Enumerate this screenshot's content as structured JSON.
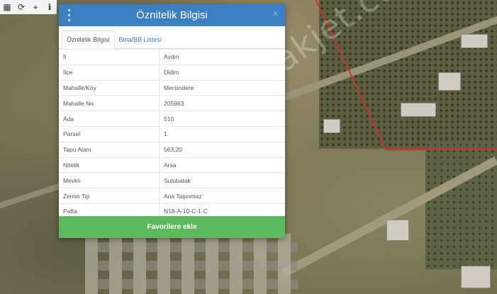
{
  "map": {
    "watermark": "emlakjet.com",
    "toolbar": [
      {
        "name": "grid-icon",
        "glyph": "▦"
      },
      {
        "name": "refresh-icon",
        "glyph": "⟳"
      },
      {
        "name": "crosshair-icon",
        "glyph": "⌖"
      },
      {
        "name": "info-icon",
        "glyph": "ℹ"
      }
    ]
  },
  "dialog": {
    "title": "Öznitelik Bilgisi",
    "close": "×",
    "tabs": [
      {
        "label": "Öznitelik Bilgisi",
        "active": true
      },
      {
        "label": "Bina/BB Listesi",
        "active": false
      }
    ],
    "rows": [
      {
        "label": "İl",
        "value": "Aydın"
      },
      {
        "label": "İlçe",
        "value": "Didim"
      },
      {
        "label": "Mahalle/Köy",
        "value": "Mersindere"
      },
      {
        "label": "Mahalle No",
        "value": "205963"
      },
      {
        "label": "Ada",
        "value": "510"
      },
      {
        "label": "Parsel",
        "value": "1"
      },
      {
        "label": "Tapu Alanı",
        "value": "563,20"
      },
      {
        "label": "Nitelik",
        "value": "Arsa"
      },
      {
        "label": "Mevkii",
        "value": "Sulubatak"
      },
      {
        "label": "Zemin Tip",
        "value": "Ana Taşınmaz"
      },
      {
        "label": "Pafta",
        "value": "N18-A-10-C-1-C"
      }
    ],
    "favorite_button": "Favorilere ekle"
  },
  "colors": {
    "header": "#3a7fc2",
    "button": "#5cb85c",
    "parcel_border": "#d0302c"
  }
}
